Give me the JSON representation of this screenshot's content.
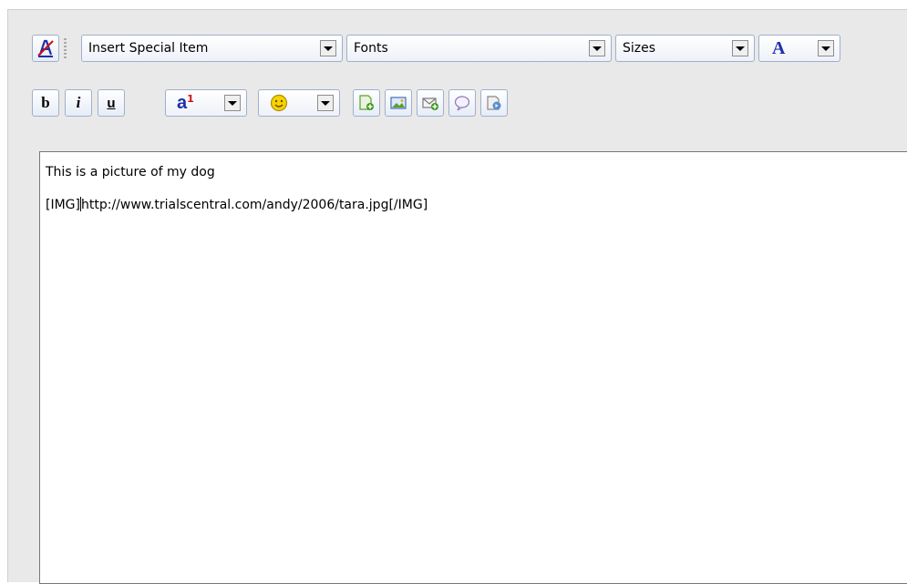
{
  "toolbar": {
    "row1": {
      "special_item": "Insert Special Item",
      "fonts": "Fonts",
      "sizes": "Sizes",
      "font_color_glyph": "A"
    },
    "row2": {
      "bold": "b",
      "italic": "i",
      "underline": "u",
      "text_style_glyph": "a"
    },
    "icons": [
      "remove-format-icon",
      "font-color-icon",
      "text-style-icon",
      "smiley-icon",
      "insert-link-icon",
      "insert-image-icon",
      "insert-email-icon",
      "insert-quote-icon",
      "insert-code-icon"
    ]
  },
  "editor": {
    "line1": "This is a picture of my dog",
    "line2_before_caret": "[IMG]",
    "line2_after_caret": "http://www.trialscentral.com/andy/2006/tara.jpg[/IMG]"
  },
  "colors": {
    "panel_bg": "#e9e9e9",
    "button_border": "#9fb0cc",
    "accent_blue": "#1f2fa8"
  }
}
